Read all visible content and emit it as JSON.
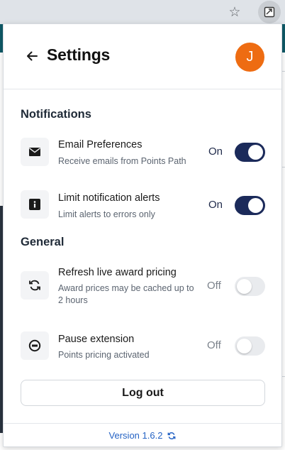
{
  "header": {
    "title": "Settings",
    "avatar_initial": "J"
  },
  "sections": {
    "notifications": "Notifications",
    "general": "General"
  },
  "rows": [
    {
      "title": "Email Preferences",
      "desc": "Receive emails from Points Path",
      "state": "On",
      "icon": "envelope-icon"
    },
    {
      "title": "Limit notification alerts",
      "desc": "Limit alerts to errors only",
      "state": "On",
      "icon": "info-icon"
    },
    {
      "title": "Refresh live award pricing",
      "desc": "Award prices may be cached up to 2 hours",
      "state": "Off",
      "icon": "refresh-icon"
    },
    {
      "title": "Pause extension",
      "desc": "Points pricing activated",
      "state": "Off",
      "icon": "pause-icon"
    }
  ],
  "logout_label": "Log out",
  "version": "Version 1.6.2",
  "colors": {
    "avatar": "#ee6c12",
    "toggle_on": "#1b2a5a",
    "toggle_off": "#e9ebee",
    "link": "#2563c4"
  }
}
